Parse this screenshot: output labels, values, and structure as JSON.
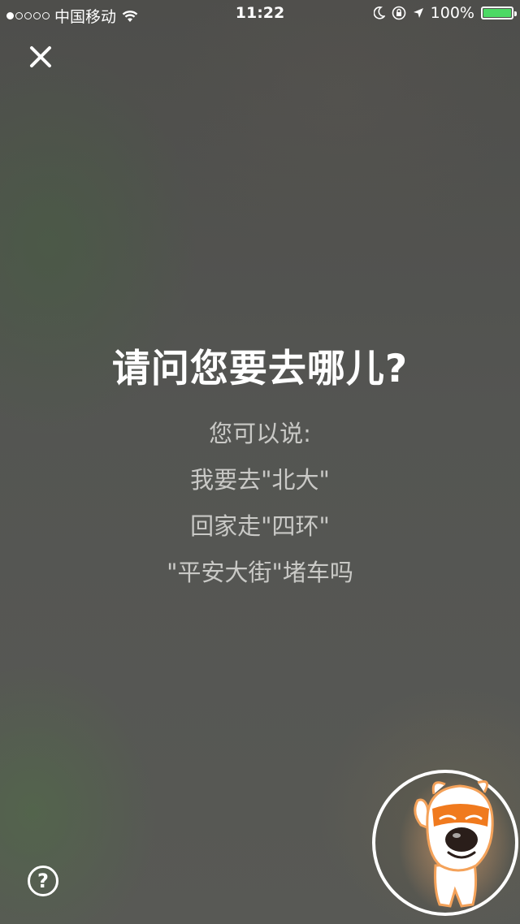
{
  "status_bar": {
    "carrier": "中国移动",
    "time": "11:22",
    "battery_percent": "100%",
    "battery_level": 1.0,
    "battery_color": "#4cd964",
    "signal_dots_filled": 1,
    "signal_dots_total": 5
  },
  "close_button": {
    "icon": "close-icon"
  },
  "prompt": {
    "title": "请问您要去哪儿?",
    "subtitle": "您可以说:",
    "examples": [
      "我要去\"北大\"",
      "回家走\"四环\"",
      "\"平安大街\"堵车吗"
    ]
  },
  "help_button": {
    "icon": "question-circle-icon",
    "label": "?"
  },
  "voice_assistant": {
    "icon": "mascot-dog-icon",
    "accent_color": "#f07a1e"
  }
}
